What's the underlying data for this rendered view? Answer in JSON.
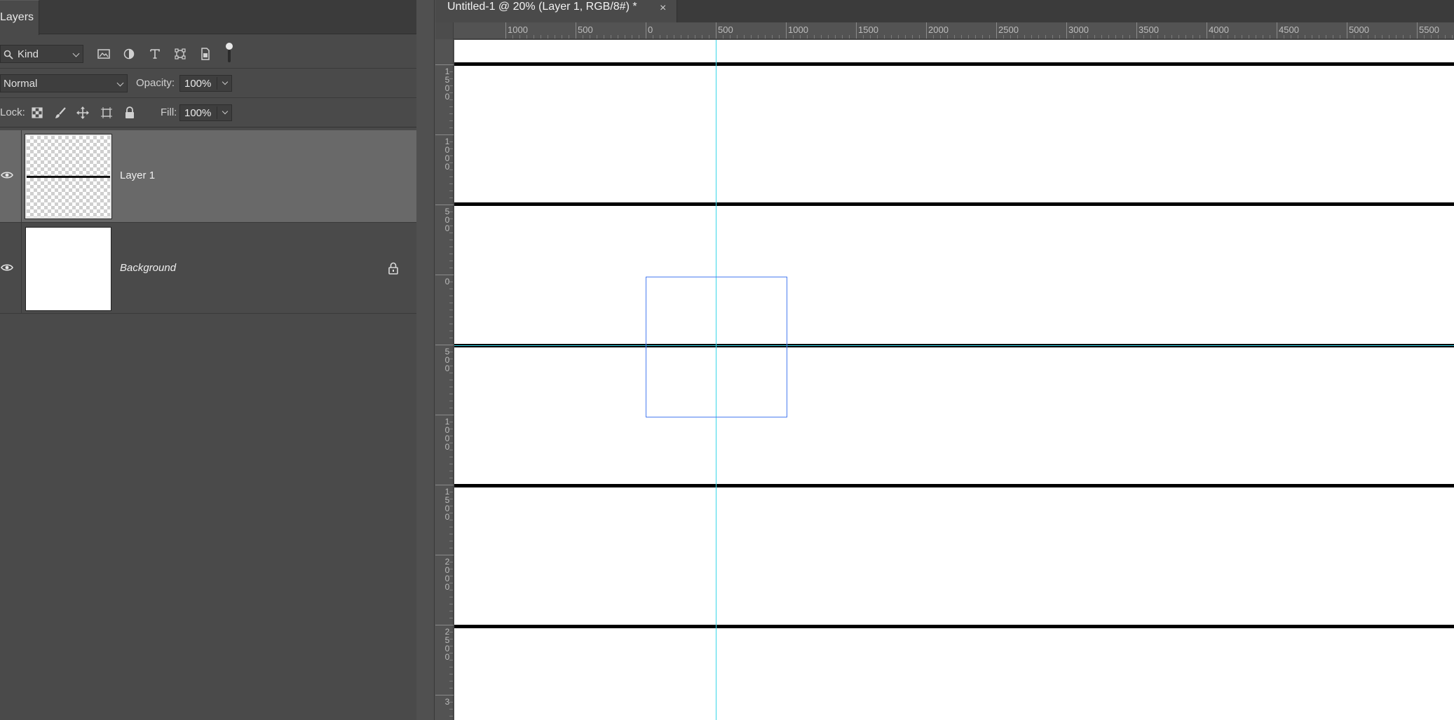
{
  "layers_panel": {
    "tab_label": "Layers",
    "filter_kind": "Kind",
    "filter_icons": [
      "image-filter-icon",
      "adjustment-filter-icon",
      "type-filter-icon",
      "shape-filter-icon",
      "smart-object-filter-icon"
    ],
    "blend_mode": "Normal",
    "opacity_label": "Opacity:",
    "opacity_value": "100%",
    "lock_label": "Lock:",
    "fill_label": "Fill:",
    "fill_value": "100%",
    "layers": [
      {
        "name": "Layer 1",
        "visible": true,
        "selected": true
      },
      {
        "name": "Background",
        "visible": true,
        "locked": true
      }
    ]
  },
  "document": {
    "tab_title": "Untitled-1 @ 20% (Layer 1, RGB/8#) *",
    "close_glyph": "×"
  },
  "rulers": {
    "horizontal_labels": [
      "1000",
      "500",
      "0",
      "500",
      "1000",
      "1500",
      "2000",
      "2500",
      "3000",
      "3500",
      "4000",
      "4500",
      "5000",
      "5500"
    ],
    "vertical_labels": [
      "1500",
      "1000",
      "500",
      "0",
      "500",
      "1000",
      "1500",
      "2000",
      "2500",
      "3"
    ]
  },
  "colors": {
    "guide": "#38d6e8",
    "selection": "#4a7cf0",
    "panel_bg": "#4a4a4a",
    "selected_layer_bg": "#696969"
  }
}
